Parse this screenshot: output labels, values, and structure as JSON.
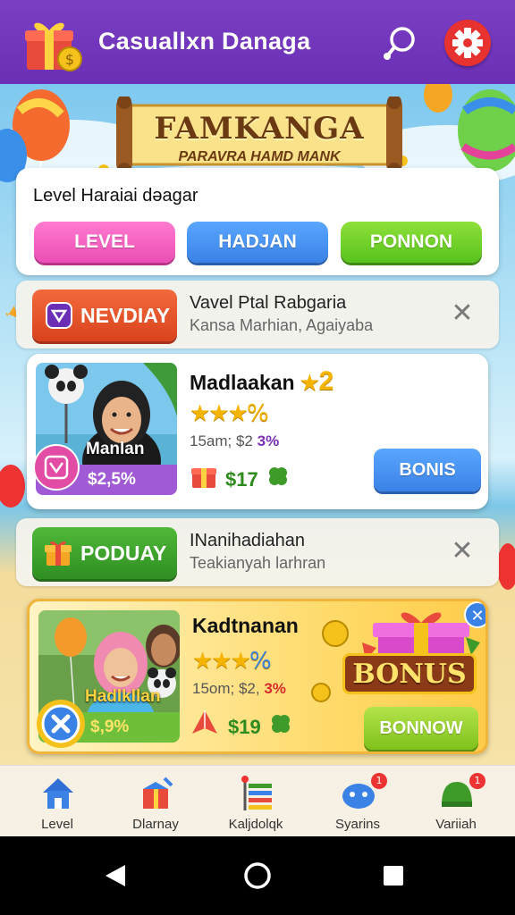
{
  "app": {
    "title": "Casuallxn Danaga",
    "accent": "#6a2fb5"
  },
  "toolbar": {
    "search_icon": "search-icon",
    "settings_icon": "gear-icon"
  },
  "banner": {
    "title": "FAMKANGA",
    "subtitle": "PARAVRA HAMD MANK"
  },
  "level_card": {
    "heading": "Level Haraiai dəagar",
    "tabs": [
      {
        "label": "LEVEL",
        "color": "#ec4fb5"
      },
      {
        "label": "HADJAN",
        "color": "#3a82e6"
      },
      {
        "label": "PONNON",
        "color": "#58c21c"
      }
    ]
  },
  "notifications": [
    {
      "badge": "NEVDIAY",
      "title": "Vavel Ptal Rabgaria",
      "subtitle": "Kansa Marhian, Agaiyaba",
      "color": "#e2502c"
    },
    {
      "badge": "PODUAY",
      "title": "INanihadiahan",
      "subtitle": "Teakianyah larhran",
      "color": "#3e9b2a"
    }
  ],
  "offers": [
    {
      "title": "Madlaakan",
      "title_badge": "2",
      "stars": "★★★",
      "stars_extra": "%",
      "meta": "15am; $2",
      "meta_pct": "3%",
      "photo_name": "Manlan",
      "photo_price": "$2,5%",
      "price": "$17",
      "cta": "BONIS"
    },
    {
      "title": "Kadtnanan",
      "stars": "★★★",
      "stars_extra": "%",
      "meta": "15om; $2,",
      "meta_pct": "3%",
      "photo_name": "Hadlkllan",
      "photo_price": "$,9%",
      "price": "$19",
      "bonus_label": "BONUS",
      "cta": "BONNOW"
    }
  ],
  "bottom_nav": [
    {
      "label": "Level",
      "icon": "home-icon"
    },
    {
      "label": "Dlarnay",
      "icon": "gift-box-icon"
    },
    {
      "label": "Kaljdolqk",
      "icon": "flag-list-icon"
    },
    {
      "label": "Syarins",
      "icon": "game-controller-icon",
      "badge": "1"
    },
    {
      "label": "Variiah",
      "icon": "helmet-icon",
      "badge": "1"
    }
  ]
}
